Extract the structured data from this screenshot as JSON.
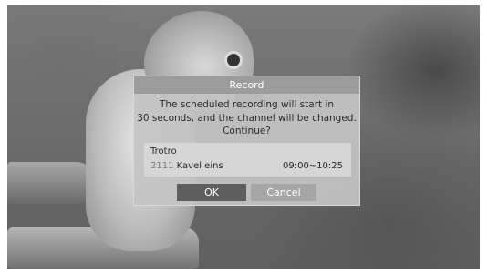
{
  "dialog": {
    "title": "Record",
    "message_lines": [
      "The scheduled recording will start in",
      "30 seconds, and the channel will be changed.",
      "Continue?"
    ],
    "program": {
      "name": "Trotro",
      "channel_number": "2111",
      "channel_name": "Kavel eins",
      "time_range": "09:00~10:25"
    },
    "buttons": {
      "ok": "OK",
      "cancel": "Cancel"
    },
    "focused_button": "ok"
  },
  "colors": {
    "dialog_title_bg": "#9c9c9c",
    "button_focused": "#5e5e5e",
    "button_normal": "#a6a6a6"
  }
}
